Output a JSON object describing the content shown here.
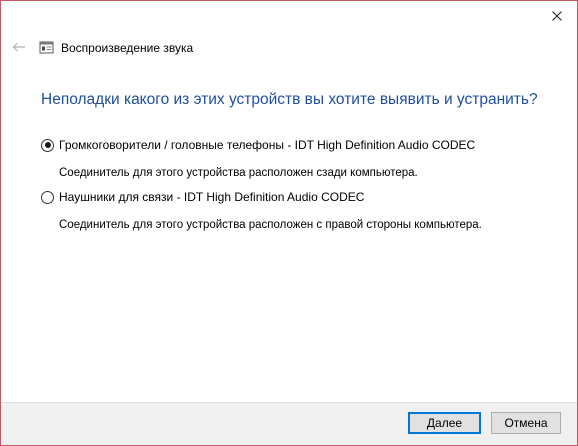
{
  "window": {
    "title": "Воспроизведение звука"
  },
  "question": "Неполадки какого из этих устройств вы хотите выявить и устранить?",
  "options": [
    {
      "label": "Громкоговорители / головные телефоны - IDT High Definition Audio CODEC",
      "description": "Соединитель для этого устройства расположен сзади компьютера.",
      "selected": true
    },
    {
      "label": "Наушники для связи - IDT High Definition Audio CODEC",
      "description": "Соединитель для этого устройства расположен с правой стороны компьютера.",
      "selected": false
    }
  ],
  "buttons": {
    "next": "Далее",
    "cancel": "Отмена"
  },
  "icons": {
    "close": "close-icon",
    "back": "back-arrow-icon",
    "app": "speaker-troubleshooter-icon"
  },
  "colors": {
    "question_text": "#1f4fa0",
    "window_border": "#c4566a",
    "default_button_border": "#0078d7",
    "footer_bg": "#f0f0f0"
  }
}
